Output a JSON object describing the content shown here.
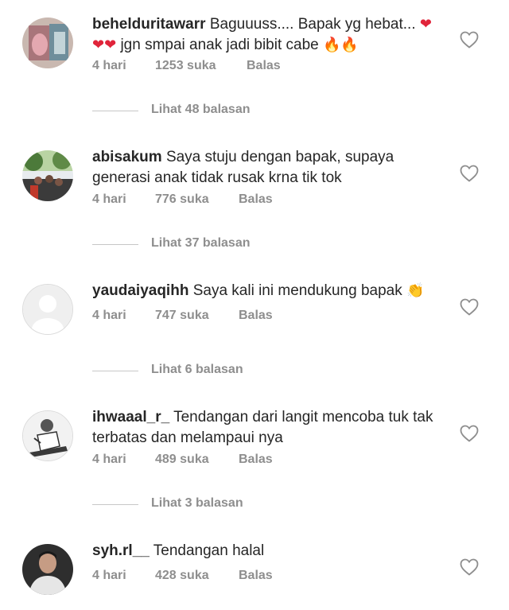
{
  "comments": [
    {
      "username": "behelduritawarr",
      "text": "Baguuuss.... Bapak yg hebat... ❤️❤️❤️ jgn smpai anak jadi bibit cabe 🔥🔥",
      "text_parts": [
        "Baguuuss.... Bapak yg hebat... ",
        "jgn smpai anak jadi bibit cabe "
      ],
      "time": "4 hari",
      "likes": "1253 suka",
      "reply": "Balas",
      "replies": "Lihat 48 balasan"
    },
    {
      "username": "abisakum",
      "text": "Saya stuju dengan bapak, supaya generasi anak tidak rusak krna tik tok",
      "time": "4 hari",
      "likes": "776 suka",
      "reply": "Balas",
      "replies": "Lihat 37 balasan"
    },
    {
      "username": "yaudaiyaqihh",
      "text": "Saya kali ini mendukung bapak 👏",
      "text_parts": [
        "Saya kali ini mendukung bapak "
      ],
      "time": "4 hari",
      "likes": "747 suka",
      "reply": "Balas",
      "replies": "Lihat 6 balasan"
    },
    {
      "username": "ihwaaal_r_",
      "text": "Tendangan dari langit mencoba tuk tak terbatas dan melampaui nya",
      "time": "4 hari",
      "likes": "489 suka",
      "reply": "Balas",
      "replies": "Lihat 3 balasan"
    },
    {
      "username": "syh.rl__",
      "text": "Tendangan halal",
      "time": "4 hari",
      "likes": "428 suka",
      "reply": "Balas"
    }
  ],
  "icons": {
    "like": "heart-outline-icon",
    "heart": "red-heart-emoji",
    "fire": "fire-emoji",
    "clap": "clapping-hands-emoji"
  },
  "colors": {
    "text": "#262626",
    "meta": "#8e8e8e",
    "heart": "#e0243a"
  }
}
